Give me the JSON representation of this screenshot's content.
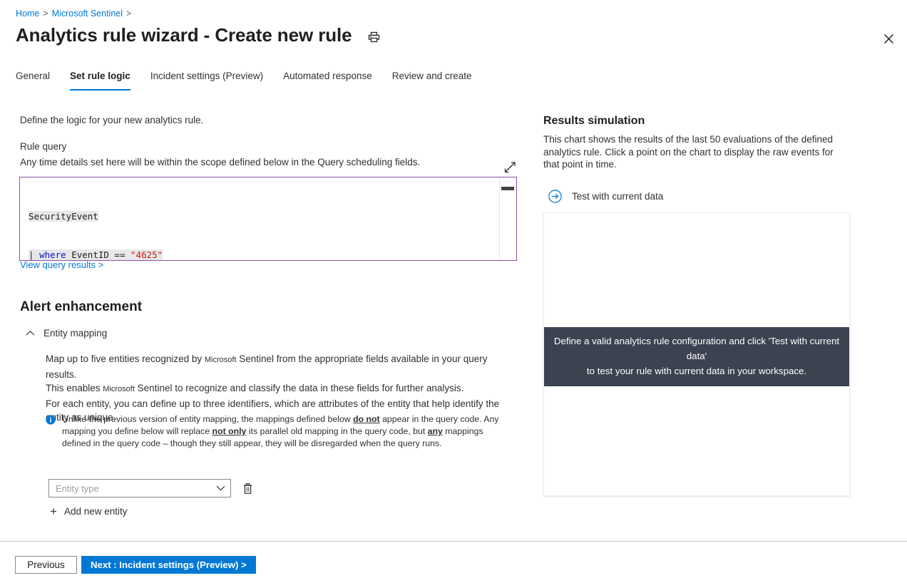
{
  "breadcrumb": {
    "home": "Home",
    "sentinel": "Microsoft Sentinel",
    "separator": ">"
  },
  "header": {
    "title": "Analytics rule wizard - Create new rule",
    "print_icon": "printer-icon",
    "close_icon": "close-icon"
  },
  "tabs": [
    {
      "label": "General",
      "active": false
    },
    {
      "label": "Set rule logic",
      "active": true
    },
    {
      "label": "Incident settings (Preview)",
      "active": false
    },
    {
      "label": "Automated response",
      "active": false
    },
    {
      "label": "Review and create",
      "active": false
    }
  ],
  "left": {
    "intro": "Define the logic for your new analytics rule.",
    "rule_query_label": "Rule query",
    "rule_query_sub": "Any time details set here will be within the scope defined below in the Query scheduling fields.",
    "expand_icon": "expand-diagonal-icon",
    "query": {
      "line1": "SecurityEvent",
      "line2_pipe": "| ",
      "line2_kw": "where",
      "line2_mid": " EventID == ",
      "line2_str": "\"4625\""
    },
    "view_query_results": "View query results >",
    "alert_enhancement_title": "Alert enhancement",
    "entity_mapping": {
      "chevron_icon": "chevron-up-icon",
      "label": "Entity mapping",
      "paragraph_1a": "Map up to five entities recognized by ",
      "paragraph_1ms": "Microsoft",
      "paragraph_1b": " Sentinel from the appropriate fields available in your query results.",
      "paragraph_2a": "This enables ",
      "paragraph_2ms": "Microsoft",
      "paragraph_2b": " Sentinel to recognize and classify the data in these fields for further analysis.",
      "paragraph_3": "For each entity, you can define up to three identifiers, which are attributes of the entity that help identify the entity as unique.",
      "info_icon": "info-icon",
      "info_part1": "Unlike the previous version of entity mapping, the mappings defined below ",
      "info_bold1": "do not",
      "info_part2": " appear in the query code. Any mapping you define below will replace ",
      "info_bold2": "not only",
      "info_part3": " its parallel old mapping in the query code, but ",
      "info_bold3": "any",
      "info_part4": " mappings defined in the query code – though they still appear, they will be disregarded when the query runs.",
      "entity_type_placeholder": "Entity type",
      "entity_type_value": "",
      "chevron_down_icon": "chevron-down-icon",
      "delete_icon": "trash-icon",
      "add_new_entity": "Add new entity",
      "add_icon": "plus-icon"
    }
  },
  "right": {
    "title": "Results simulation",
    "description": "This chart shows the results of the last 50 evaluations of the defined analytics rule. Click a point on the chart to display the raw events for that point in time.",
    "test_icon": "arrow-right-circle-icon",
    "test_label": "Test with current data",
    "chart_placeholder_line1": "Define a valid analytics rule configuration and click 'Test with current data'",
    "chart_placeholder_line2": "to test your rule with current data in your workspace."
  },
  "footer": {
    "previous": "Previous",
    "next": "Next : Incident settings (Preview) >"
  },
  "colors": {
    "accent": "#0078d4",
    "editor_border": "#8e4ea8",
    "overlay_bg": "#3b4250",
    "keyword": "#1010cf",
    "string": "#c41a16"
  }
}
